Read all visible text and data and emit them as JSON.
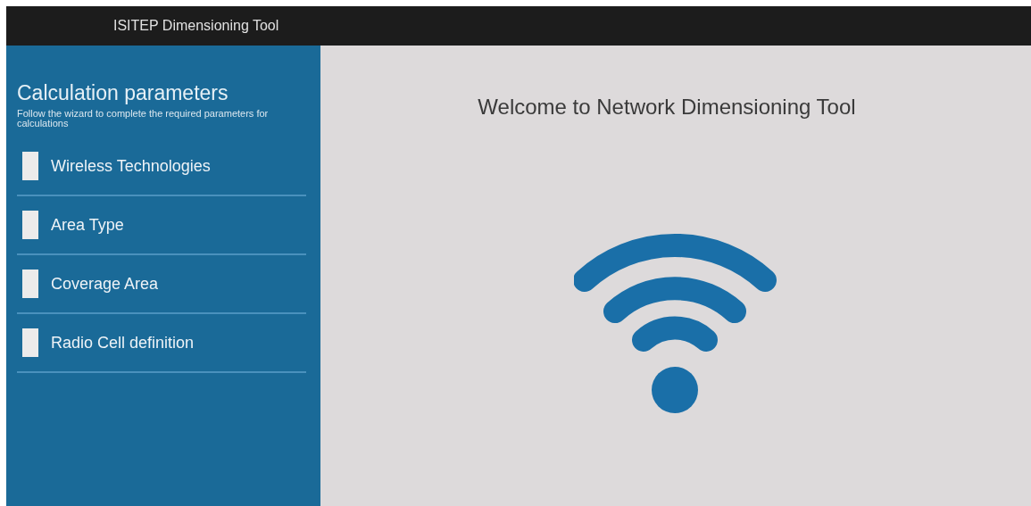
{
  "app_bar": {
    "title": "ISITEP Dimensioning Tool"
  },
  "sidebar": {
    "title": "Calculation parameters",
    "subtitle": "Follow the wizard to complete the required parameters for calculations",
    "steps": [
      {
        "label": "Wireless Technologies"
      },
      {
        "label": "Area Type"
      },
      {
        "label": "Coverage Area"
      },
      {
        "label": "Radio Cell definition"
      }
    ]
  },
  "main": {
    "heading": "Welcome to Network Dimensioning Tool"
  }
}
